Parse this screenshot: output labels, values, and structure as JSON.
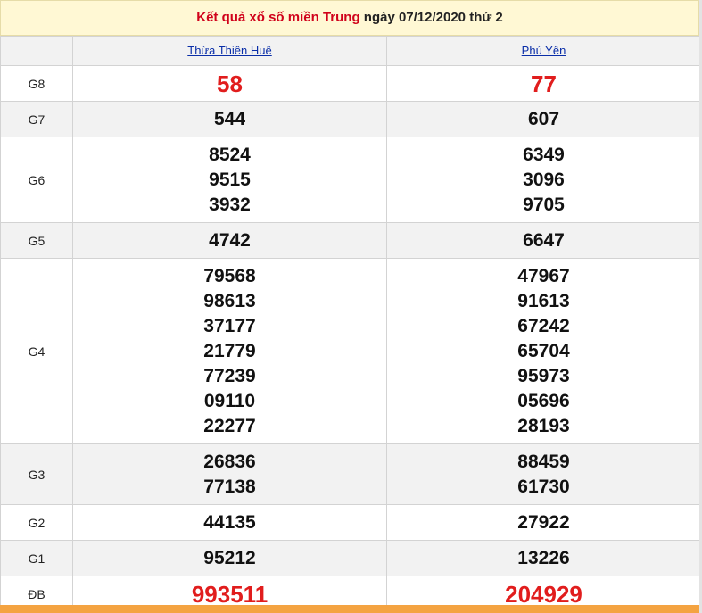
{
  "header": {
    "title_prefix": "Kết quả xổ số miền Trung",
    "title_suffix": " ngày 07/12/2020 thứ 2"
  },
  "provinces": [
    "Thừa Thiên Huế",
    "Phú Yên"
  ],
  "rows": [
    {
      "label": "G8",
      "col1": [
        "58"
      ],
      "col2": [
        "77"
      ],
      "red": true
    },
    {
      "label": "G7",
      "col1": [
        "544"
      ],
      "col2": [
        "607"
      ]
    },
    {
      "label": "G6",
      "col1": [
        "8524",
        "9515",
        "3932"
      ],
      "col2": [
        "6349",
        "3096",
        "9705"
      ]
    },
    {
      "label": "G5",
      "col1": [
        "4742"
      ],
      "col2": [
        "6647"
      ]
    },
    {
      "label": "G4",
      "col1": [
        "79568",
        "98613",
        "37177",
        "21779",
        "77239",
        "09110",
        "22277"
      ],
      "col2": [
        "47967",
        "91613",
        "67242",
        "65704",
        "95973",
        "05696",
        "28193"
      ]
    },
    {
      "label": "G3",
      "col1": [
        "26836",
        "77138"
      ],
      "col2": [
        "88459",
        "61730"
      ]
    },
    {
      "label": "G2",
      "col1": [
        "44135"
      ],
      "col2": [
        "27922"
      ]
    },
    {
      "label": "G1",
      "col1": [
        "95212"
      ],
      "col2": [
        "13226"
      ]
    },
    {
      "label": "ĐB",
      "col1": [
        "993511"
      ],
      "col2": [
        "204929"
      ],
      "red": true
    }
  ]
}
